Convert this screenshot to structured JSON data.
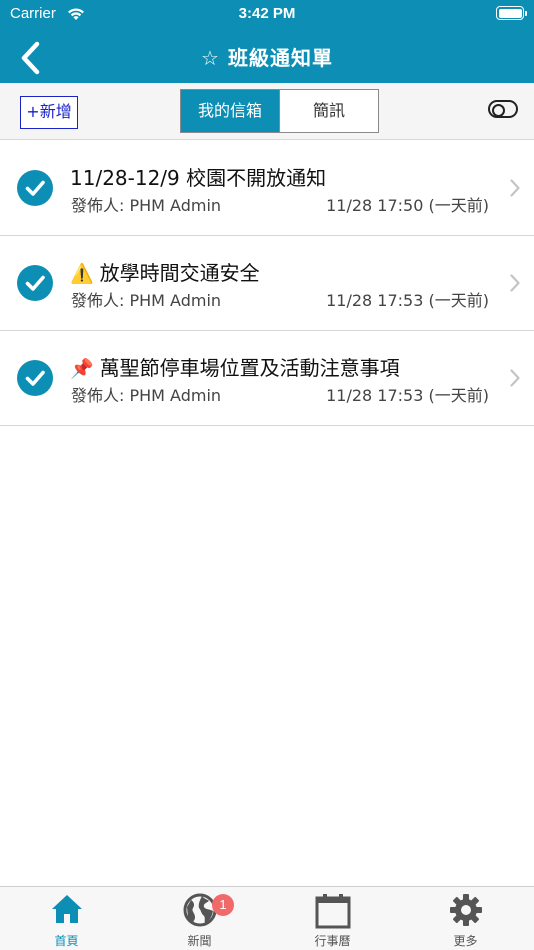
{
  "status_bar": {
    "carrier": "Carrier",
    "time": "3:42 PM"
  },
  "nav": {
    "title": "☆ 班級通知單",
    "back_icon": "chevron-left-icon"
  },
  "toolbar": {
    "add_label": "+新增",
    "segments": [
      {
        "label": "我的信箱",
        "selected": true
      },
      {
        "label": "簡訊",
        "selected": false
      }
    ]
  },
  "notices": [
    {
      "emoji": "",
      "title": "11/28-12/9 校園不開放通知",
      "sender": "發佈人: PHM Admin",
      "date": "11/28 17:50 (一天前)",
      "read": true
    },
    {
      "emoji": "⚠️",
      "title": "放學時間交通安全",
      "sender": "發佈人: PHM Admin",
      "date": "11/28 17:53 (一天前)",
      "read": true
    },
    {
      "emoji": "📌",
      "title": "萬聖節停車場位置及活動注意事項",
      "sender": "發佈人: PHM Admin",
      "date": "11/28 17:53 (一天前)",
      "read": true
    }
  ],
  "tabs": [
    {
      "label": "首頁",
      "icon": "home-icon",
      "active": true
    },
    {
      "label": "新聞",
      "icon": "globe-icon",
      "badge": "1"
    },
    {
      "label": "行事曆",
      "icon": "calendar-icon"
    },
    {
      "label": "更多",
      "icon": "gear-icon"
    }
  ],
  "colors": {
    "primary": "#0d8fb5",
    "add_button": "#1a22c9",
    "badge": "#f06a6a"
  }
}
